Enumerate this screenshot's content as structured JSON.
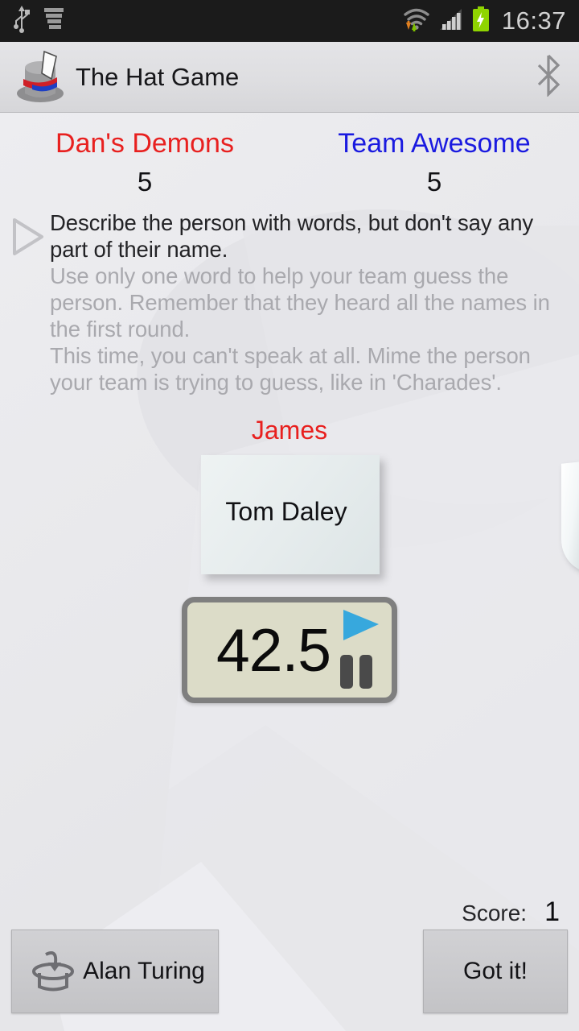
{
  "status_bar": {
    "clock": "16:37",
    "icons": [
      "usb-icon",
      "notifications-stack-icon",
      "wifi-icon",
      "data-transfer-icon",
      "cellular-signal-icon",
      "battery-charging-icon"
    ],
    "clock_color": "#d2d2d2",
    "background": "#1b1b1b"
  },
  "app_bar": {
    "title": "The Hat Game",
    "logo": "top-hat-logo-icon",
    "right_icon": "bluetooth-icon"
  },
  "teams": [
    {
      "name": "Dan's Demons",
      "score": "5",
      "color": "#e8201f"
    },
    {
      "name": "Team Awesome",
      "score": "5",
      "color": "#1a1ae0"
    }
  ],
  "instructions": {
    "marker_icon": "play-triangle-outline-icon",
    "active": "Describe the person with words, but don't say any part of their name.",
    "inactive_1": "Use only one word to help your team guess the person. Remember that they heard all the names in the first round.",
    "inactive_2": "This time, you can't speak at all. Mime the person your team is trying to guess, like in 'Charades'."
  },
  "current_player": "James",
  "card": {
    "word": "Tom Daley"
  },
  "timer": {
    "value": "42.5",
    "play_icon": "play-triangle-icon",
    "pause_icon": "pause-icon",
    "play_color": "#37a8dd",
    "pause_color": "#4a4a4a",
    "face_color": "#dcdcc8"
  },
  "score": {
    "label": "Score:",
    "value": "1"
  },
  "buttons": {
    "pass": {
      "label": "Alan Turing",
      "icon": "hat-return-icon"
    },
    "got_it": {
      "label": "Got it!"
    }
  }
}
